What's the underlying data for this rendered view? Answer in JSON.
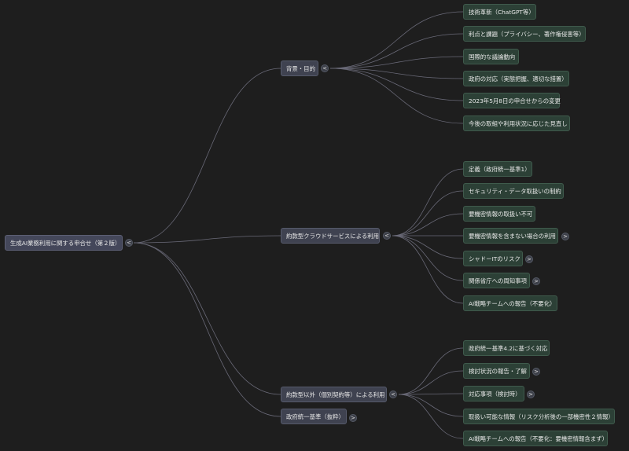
{
  "root": {
    "label": "生成AI業務利用に関する申合せ（第２版）",
    "toggle": "<"
  },
  "branches": [
    {
      "label": "背景・目的",
      "toggle": "<",
      "children": [
        {
          "label": "技術革新（ChatGPT等）"
        },
        {
          "label": "利点と課題（プライバシー、著作権侵害等）"
        },
        {
          "label": "国際的な議論動向"
        },
        {
          "label": "政府の対応（実態把握、適切な措置）"
        },
        {
          "label": "2023年5月8日の申合せからの変更"
        },
        {
          "label": "今後の取組や利用状況に応じた見直し"
        }
      ]
    },
    {
      "label": "約款型クラウドサービスによる利用",
      "toggle": "<",
      "children": [
        {
          "label": "定義（政府統一基準1）"
        },
        {
          "label": "セキュリティ・データ取扱いの制約"
        },
        {
          "label": "要機密情報の取扱い不可"
        },
        {
          "label": "要機密情報を含まない場合の利用",
          "toggle": ">"
        },
        {
          "label": "シャドーITのリスク",
          "toggle": ">"
        },
        {
          "label": "関係省庁への周知事項",
          "toggle": ">"
        },
        {
          "label": "AI戦略チームへの報告（不要化）"
        }
      ]
    },
    {
      "label": "約款型以外（個別契約等）による利用",
      "toggle": "<",
      "children": [
        {
          "label": "政府統一基準4.2に基づく対応"
        },
        {
          "label": "検討状況の報告・了解",
          "toggle": ">"
        },
        {
          "label": "対応事項（検討時）",
          "toggle": ">"
        },
        {
          "label": "取扱い可能な情報（リスク分析後の一部機密性２情報）"
        },
        {
          "label": "AI戦略チームへの報告（不要化：要機密情報含まず）"
        }
      ]
    },
    {
      "label": "政府統一基準（抜粋）",
      "toggle": ">",
      "children": []
    }
  ],
  "colors": {
    "edge": "#6a6a78",
    "background": "#1e1e1e"
  }
}
